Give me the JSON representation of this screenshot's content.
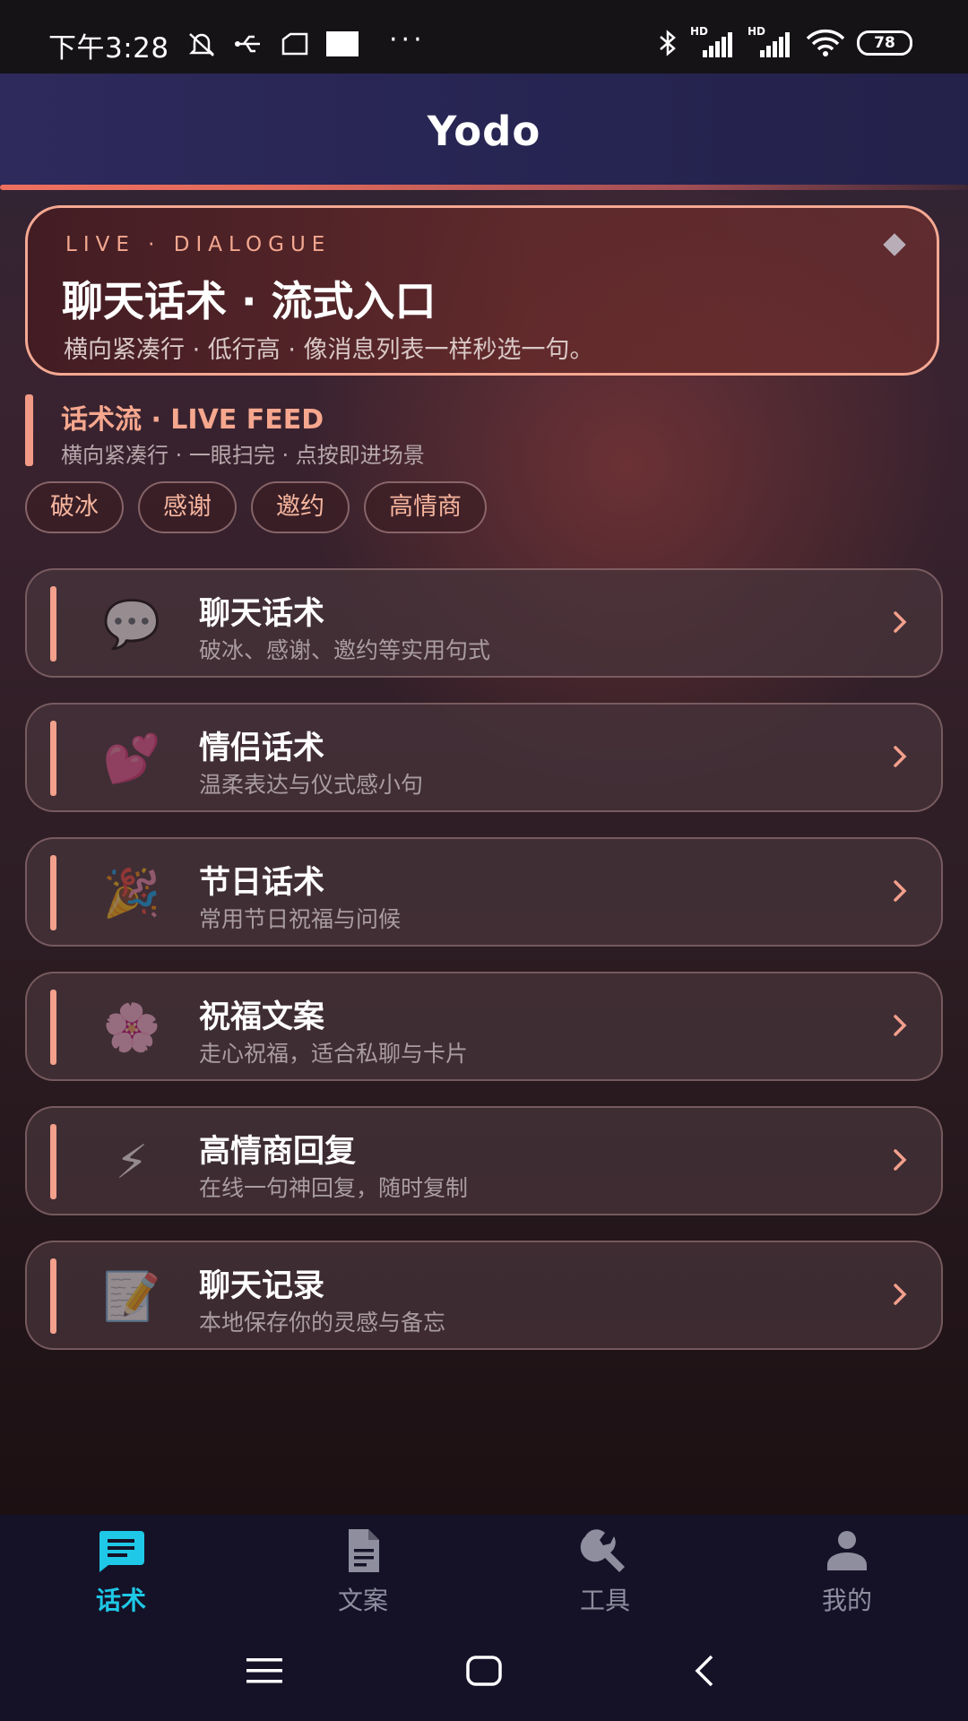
{
  "status_bar": {
    "time": "下午3:28",
    "battery": "78",
    "more": "···"
  },
  "app_title": "Yodo",
  "hero": {
    "kicker": "LIVE · DIALOGUE",
    "title": "聊天话术 · 流式入口",
    "subtitle": "横向紧凑行 · 低行高 · 像消息列表一样秒选一句。"
  },
  "section": {
    "title": "话术流 · LIVE FEED",
    "subtitle": "横向紧凑行 · 一眼扫完 · 点按即进场景"
  },
  "chips": [
    "破冰",
    "感谢",
    "邀约",
    "高情商"
  ],
  "cards": [
    {
      "title": "聊天话术",
      "subtitle": "破冰、感谢、邀约等实用句式",
      "icon": "💬",
      "icon_name": "speech-bubble-icon"
    },
    {
      "title": "情侣话术",
      "subtitle": "温柔表达与仪式感小句",
      "icon": "💕",
      "icon_name": "two-hearts-icon"
    },
    {
      "title": "节日话术",
      "subtitle": "常用节日祝福与问候",
      "icon": "🎉",
      "icon_name": "party-popper-icon"
    },
    {
      "title": "祝福文案",
      "subtitle": "走心祝福，适合私聊与卡片",
      "icon": "🌸",
      "icon_name": "cherry-blossom-icon"
    },
    {
      "title": "高情商回复",
      "subtitle": "在线一句神回复，随时复制",
      "icon": "⚡",
      "icon_name": "lightning-icon"
    },
    {
      "title": "聊天记录",
      "subtitle": "本地保存你的灵感与备忘",
      "icon": "📝",
      "icon_name": "memo-icon"
    }
  ],
  "nav": [
    {
      "label": "话术",
      "active": true
    },
    {
      "label": "文案",
      "active": false
    },
    {
      "label": "工具",
      "active": false
    },
    {
      "label": "我的",
      "active": false
    }
  ],
  "colors": {
    "accent": "#f3a08c",
    "nav_active": "#1ec8e6",
    "nav_inactive": "#8e8e9e",
    "header": "#2a2758"
  }
}
